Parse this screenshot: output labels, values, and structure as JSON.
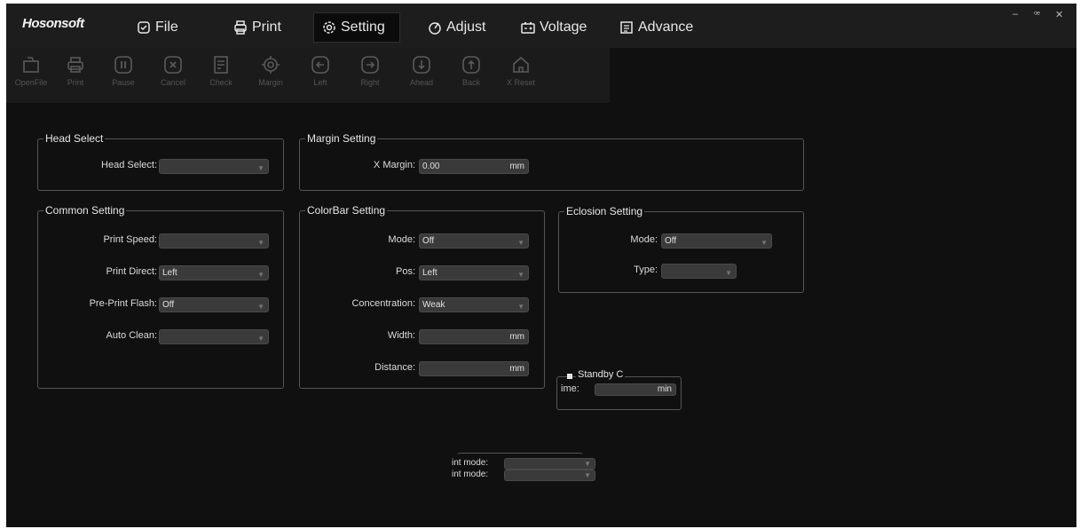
{
  "app": {
    "logo": "Hosonsoft"
  },
  "window_controls": {
    "minimize": "–",
    "restore": "ꟹ",
    "close": "✕"
  },
  "menu": [
    {
      "label": "File",
      "icon": "file-icon"
    },
    {
      "label": "Print",
      "icon": "print-icon"
    },
    {
      "label": "Setting",
      "icon": "gear-icon",
      "active": true
    },
    {
      "label": "Adjust",
      "icon": "adjust-icon"
    },
    {
      "label": "Voltage",
      "icon": "battery-icon"
    },
    {
      "label": "Advance",
      "icon": "document-icon"
    }
  ],
  "toolbar": [
    {
      "label": "OpenFile",
      "icon": "open-file-icon"
    },
    {
      "label": "Print",
      "icon": "print-icon"
    },
    {
      "label": "Pause",
      "icon": "pause-icon"
    },
    {
      "label": "Cancel",
      "icon": "cancel-icon"
    },
    {
      "label": "Check",
      "icon": "check-icon"
    },
    {
      "label": "Margin",
      "icon": "margin-icon"
    },
    {
      "label": "Left",
      "icon": "arrow-left-icon"
    },
    {
      "label": "Right",
      "icon": "arrow-right-icon"
    },
    {
      "label": "Ahead",
      "icon": "arrow-down-icon"
    },
    {
      "label": "Back",
      "icon": "arrow-up-icon"
    },
    {
      "label": "X Reset",
      "icon": "home-icon"
    }
  ],
  "head_select": {
    "title": "Head Select",
    "label": "Head Select:",
    "value": ""
  },
  "margin_setting": {
    "title": "Margin Setting",
    "label": "X Margin:",
    "value": "0.00",
    "unit": "mm"
  },
  "common_setting": {
    "title": "Common Setting",
    "print_speed": {
      "label": "Print Speed:",
      "value": ""
    },
    "print_direct": {
      "label": "Print Direct:",
      "value": "Left"
    },
    "pre_print_flash": {
      "label": "Pre-Print Flash:",
      "value": "Off"
    },
    "auto_clean": {
      "label": "Auto Clean:",
      "value": ""
    }
  },
  "colorbar_setting": {
    "title": "ColorBar Setting",
    "mode": {
      "label": "Mode:",
      "value": "Off"
    },
    "pos": {
      "label": "Pos:",
      "value": "Left"
    },
    "concentration": {
      "label": "Concentration:",
      "value": "Weak"
    },
    "width": {
      "label": "Width:",
      "value": "",
      "unit": "mm"
    },
    "distance": {
      "label": "Distance:",
      "value": "",
      "unit": "mm"
    }
  },
  "eclosion_setting": {
    "title": "Eclosion Setting",
    "mode": {
      "label": "Mode:",
      "value": "Off"
    },
    "type": {
      "label": "Type:",
      "value": ""
    }
  },
  "standby": {
    "title": "Standby C",
    "label": "ime:",
    "value": "",
    "unit": "min"
  },
  "print_mode": {
    "label1": "int mode:",
    "label2": "int mode:",
    "value1": "",
    "value2": ""
  }
}
